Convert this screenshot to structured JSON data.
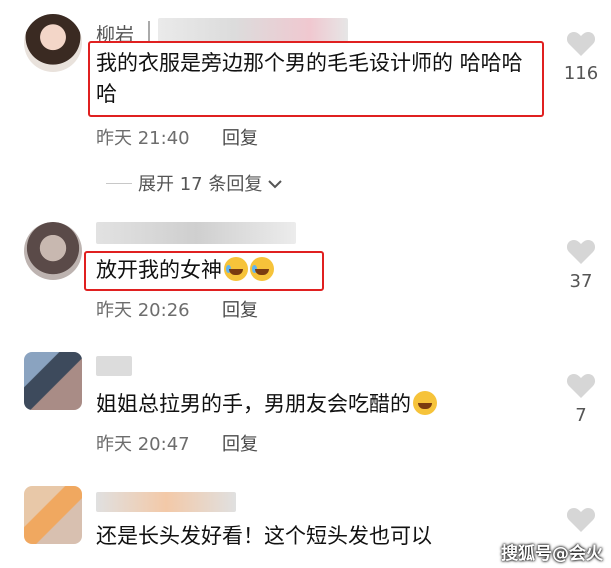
{
  "comments": [
    {
      "name": "柳岩",
      "text": "我的衣服是旁边那个男的毛毛设计师的 哈哈哈哈",
      "time": "昨天 21:40",
      "reply": "回复",
      "likes": "116"
    },
    {
      "name": "",
      "text": "放开我的女神",
      "time": "昨天 20:26",
      "reply": "回复",
      "likes": "37"
    },
    {
      "name": "",
      "text": "姐姐总拉男的手，男朋友会吃醋的",
      "time": "昨天 20:47",
      "reply": "回复",
      "likes": "7"
    },
    {
      "name": "",
      "text": "还是长头发好看！这个短头发也可以",
      "time": "",
      "reply": "",
      "likes": ""
    }
  ],
  "expand": {
    "label": "展开 17 条回复"
  },
  "watermark": "搜狐号@会火",
  "colors": {
    "highlight_box": "#e02020",
    "heart": "#d6d6d6"
  }
}
